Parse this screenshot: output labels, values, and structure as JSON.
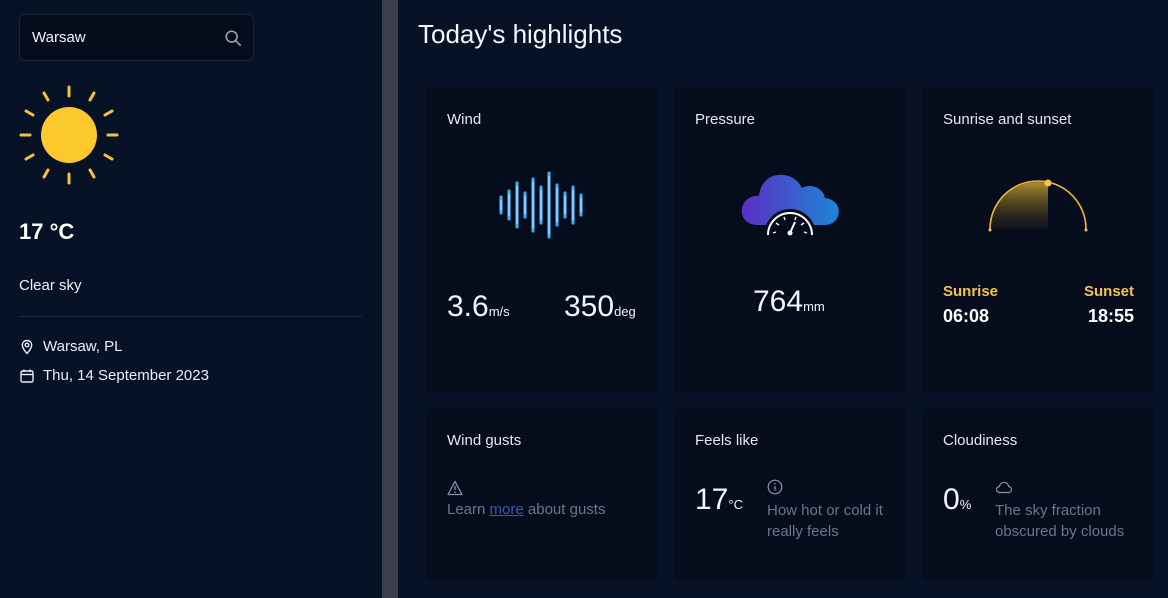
{
  "sidebar": {
    "search": {
      "value": "Warsaw",
      "icon": "search-icon"
    },
    "weather_icon": "sun-icon",
    "temperature": "17 °C",
    "description": "Clear sky",
    "location": "Warsaw, PL",
    "date": "Thu, 14 September 2023"
  },
  "main": {
    "title": "Today's highlights",
    "wind": {
      "title": "Wind",
      "speed": "3.6",
      "speed_unit": "m/s",
      "direction": "350",
      "direction_unit": "deg"
    },
    "pressure": {
      "title": "Pressure",
      "value": "764",
      "unit": "mm"
    },
    "sun": {
      "title": "Sunrise and sunset",
      "sunrise_label": "Sunrise",
      "sunrise": "06:08",
      "sunset_label": "Sunset",
      "sunset": "18:55"
    },
    "gusts": {
      "title": "Wind gusts",
      "prefix": "Learn",
      "link": "more",
      "suffix": "about gusts"
    },
    "feels": {
      "title": "Feels like",
      "value": "17",
      "unit": "°C",
      "description": "How hot or cold it really feels"
    },
    "cloudiness": {
      "title": "Cloudiness",
      "value": "0",
      "unit": "%",
      "description": "The sky fraction obscured by clouds"
    }
  },
  "colors": {
    "background": "#081226",
    "card": "#050c1c",
    "accent": "#f4c24e",
    "link": "#3b54b8"
  }
}
